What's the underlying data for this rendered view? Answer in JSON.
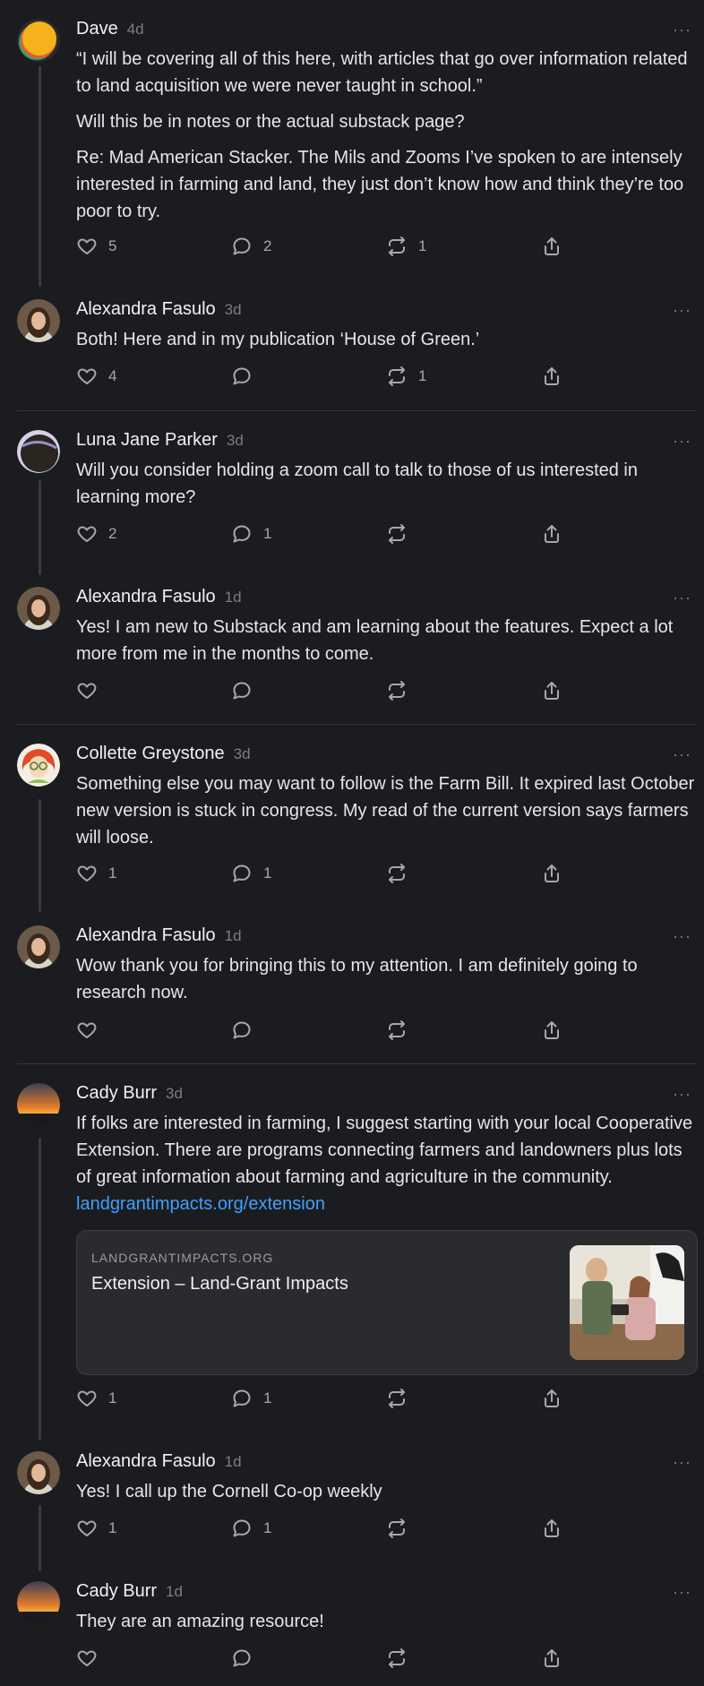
{
  "posts": [
    {
      "author": "Dave",
      "time": "4d",
      "paragraphs": [
        "“I will be covering all of this here, with articles that go over information related to land acquisition we were never taught in school.”",
        "Will this be in notes or the actual substack page?",
        "Re: Mad American Stacker. The Mils and Zooms I’ve spoken to are intensely interested in farming and land, they just don’t know how and think they’re too poor to try."
      ],
      "likes": "5",
      "comments": "2",
      "restacks": "1"
    },
    {
      "author": "Alexandra Fasulo",
      "time": "3d",
      "paragraphs": [
        "Both! Here and in my publication ‘House of Green.’"
      ],
      "likes": "4",
      "comments": "",
      "restacks": "1"
    },
    {
      "author": "Luna Jane Parker",
      "time": "3d",
      "paragraphs": [
        "Will you consider holding a zoom call to talk to those of us interested in learning more?"
      ],
      "likes": "2",
      "comments": "1",
      "restacks": ""
    },
    {
      "author": "Alexandra Fasulo",
      "time": "1d",
      "paragraphs": [
        "Yes! I am new to Substack and am learning about the features. Expect a lot more from me in the months to come."
      ],
      "likes": "",
      "comments": "",
      "restacks": ""
    },
    {
      "author": "Collette Greystone",
      "time": "3d",
      "paragraphs": [
        "Something else you may want to follow is the Farm Bill. It expired last October new version is stuck in congress. My read of the current version says farmers will loose."
      ],
      "likes": "1",
      "comments": "1",
      "restacks": ""
    },
    {
      "author": "Alexandra Fasulo",
      "time": "1d",
      "paragraphs": [
        "Wow thank you for bringing this to my attention. I am definitely going to research now."
      ],
      "likes": "",
      "comments": "",
      "restacks": ""
    },
    {
      "author": "Cady Burr",
      "time": "3d",
      "paragraphs": [
        "If folks are interested in farming, I suggest starting with your local Cooperative Extension. There are programs connecting farmers and landowners plus lots of great information about farming and agriculture in the community."
      ],
      "link": "landgrantimpacts.org/extension",
      "embed": {
        "domain": "LANDGRANTIMPACTS.ORG",
        "title": "Extension – Land-Grant Impacts"
      },
      "likes": "1",
      "comments": "1",
      "restacks": ""
    },
    {
      "author": "Alexandra Fasulo",
      "time": "1d",
      "paragraphs": [
        "Yes! I call up the Cornell Co-op weekly"
      ],
      "likes": "1",
      "comments": "1",
      "restacks": ""
    },
    {
      "author": "Cady Burr",
      "time": "1d",
      "paragraphs": [
        "They are an amazing resource!"
      ],
      "likes": "",
      "comments": "",
      "restacks": ""
    }
  ],
  "more_label": "···",
  "colors": {
    "background": "#1b1c1f",
    "link": "#3ea0ff",
    "muted": "#7c7d82"
  },
  "icons": {
    "like": "heart-icon",
    "comment": "comment-bubble-icon",
    "restack": "restack-icon",
    "share": "share-icon",
    "more": "more-dots-icon"
  }
}
